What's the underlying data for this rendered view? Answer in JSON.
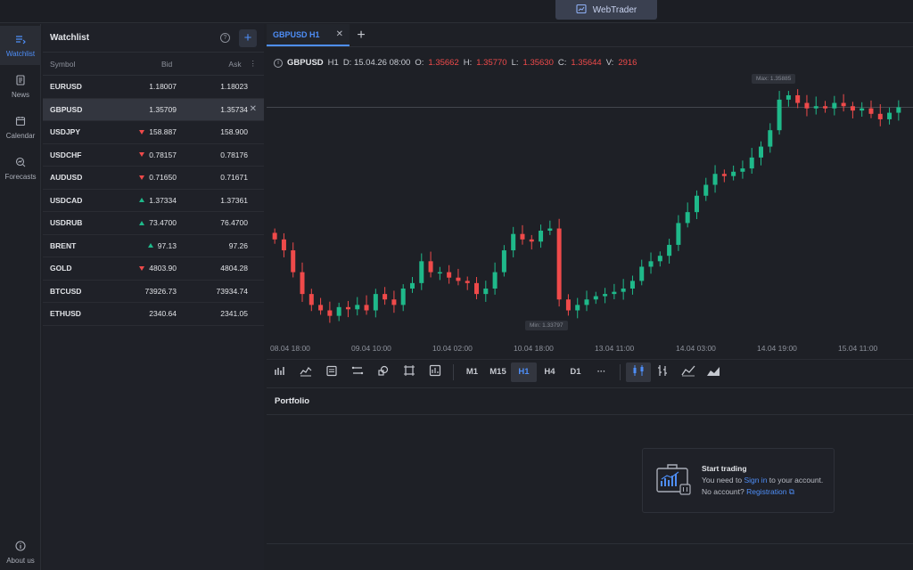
{
  "topbar": {
    "app_tab": "WebTrader"
  },
  "nav": [
    {
      "label": "Watchlist",
      "icon": "watchlist-icon"
    },
    {
      "label": "News",
      "icon": "news-icon"
    },
    {
      "label": "Calendar",
      "icon": "calendar-icon"
    },
    {
      "label": "Forecasts",
      "icon": "forecasts-icon"
    },
    {
      "label": "About us",
      "icon": "info-icon"
    }
  ],
  "watchlist": {
    "title": "Watchlist",
    "columns": {
      "symbol": "Symbol",
      "bid": "Bid",
      "ask": "Ask"
    },
    "rows": [
      {
        "symbol": "EURUSD",
        "bid": "1.18007",
        "ask": "1.18023",
        "dir": ""
      },
      {
        "symbol": "GBPUSD",
        "bid": "1.35709",
        "ask": "1.35734",
        "dir": ""
      },
      {
        "symbol": "USDJPY",
        "bid": "158.887",
        "ask": "158.900",
        "dir": "down"
      },
      {
        "symbol": "USDCHF",
        "bid": "0.78157",
        "ask": "0.78176",
        "dir": "down"
      },
      {
        "symbol": "AUDUSD",
        "bid": "0.71650",
        "ask": "0.71671",
        "dir": "down"
      },
      {
        "symbol": "USDCAD",
        "bid": "1.37334",
        "ask": "1.37361",
        "dir": "up"
      },
      {
        "symbol": "USDRUB",
        "bid": "73.4700",
        "ask": "76.4700",
        "dir": "up"
      },
      {
        "symbol": "BRENT",
        "bid": "97.13",
        "ask": "97.26",
        "dir": "up"
      },
      {
        "symbol": "GOLD",
        "bid": "4803.90",
        "ask": "4804.28",
        "dir": "down"
      },
      {
        "symbol": "BTCUSD",
        "bid": "73926.73",
        "ask": "73934.74",
        "dir": ""
      },
      {
        "symbol": "ETHUSD",
        "bid": "2340.64",
        "ask": "2341.05",
        "dir": ""
      }
    ]
  },
  "chart": {
    "tab_label": "GBPUSD H1",
    "info": {
      "symbol": "GBPUSD",
      "timeframe": "H1",
      "date": "D: 15.04.26 08:00",
      "open_label": "O:",
      "open": "1.35662",
      "high_label": "H:",
      "high": "1.35770",
      "low_label": "L:",
      "low": "1.35630",
      "close_label": "C:",
      "close": "1.35644",
      "volume_label": "V:",
      "volume": "2916"
    },
    "max_label": "Max: 1.35885",
    "min_label": "Min: 1.33797",
    "x_labels": [
      "08.04 18:00",
      "09.04 10:00",
      "10.04 02:00",
      "10.04 18:00",
      "13.04 11:00",
      "14.04 03:00",
      "14.04 19:00",
      "15.04 11:00"
    ],
    "timeframes": [
      "M1",
      "M15",
      "H1",
      "H4",
      "D1",
      "···"
    ],
    "active_timeframe": "H1",
    "colors": {
      "up": "#1fb98a",
      "down": "#ef4a4a",
      "accent": "#4e8ef7"
    }
  },
  "chart_data": {
    "type": "candlestick",
    "symbol": "GBPUSD",
    "timeframe": "H1",
    "x_ticks": [
      "08.04 18:00",
      "09.04 10:00",
      "10.04 02:00",
      "10.04 18:00",
      "13.04 11:00",
      "14.04 03:00",
      "14.04 19:00",
      "15.04 11:00"
    ],
    "y_range": [
      1.33797,
      1.35885
    ],
    "close_path": [
      1.345,
      1.344,
      1.342,
      1.34,
      1.339,
      1.3385,
      1.338,
      1.3388,
      1.3386,
      1.339,
      1.3385,
      1.34,
      1.3395,
      1.339,
      1.3405,
      1.341,
      1.343,
      1.342,
      1.342,
      1.3415,
      1.3412,
      1.341,
      1.34,
      1.3405,
      1.342,
      1.344,
      1.3455,
      1.345,
      1.3448,
      1.3458,
      1.346,
      1.3395,
      1.3385,
      1.339,
      1.3395,
      1.3398,
      1.34,
      1.3402,
      1.3405,
      1.3412,
      1.3425,
      1.343,
      1.3435,
      1.3445,
      1.3465,
      1.3475,
      1.349,
      1.35,
      1.351,
      1.3508,
      1.3512,
      1.3515,
      1.3525,
      1.3535,
      1.355,
      1.3578,
      1.3582,
      1.3575,
      1.357,
      1.3572,
      1.357,
      1.3575,
      1.3572,
      1.3568,
      1.357,
      1.3565,
      1.356,
      1.3566,
      1.3571
    ],
    "last_price": 1.35709
  },
  "portfolio": {
    "title": "Portfolio",
    "cta_title": "Start trading",
    "line1_prefix": "You need to ",
    "line1_link": "Sign in",
    "line1_suffix": " to your account.",
    "line2_prefix": "No account? ",
    "line2_link": "Registration"
  }
}
